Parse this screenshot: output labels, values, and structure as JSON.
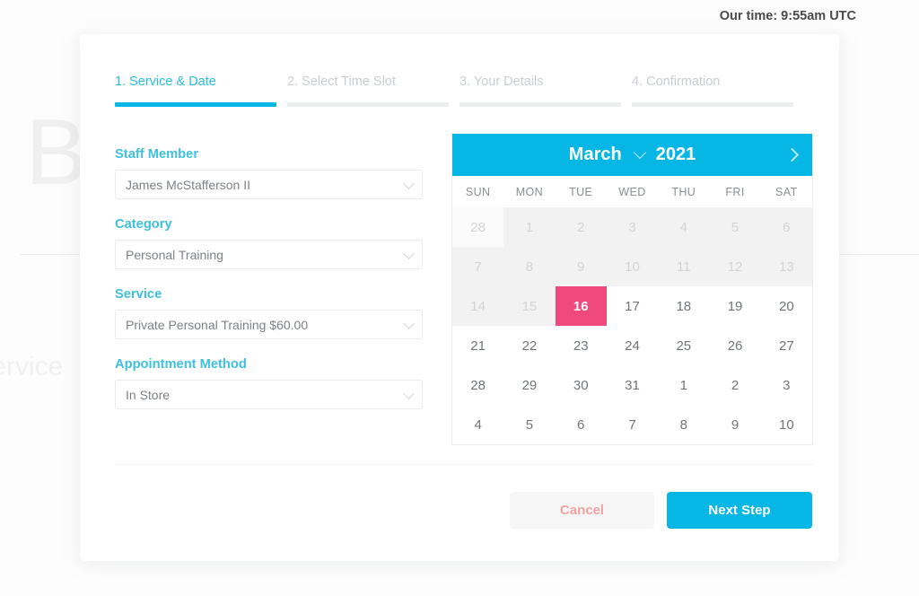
{
  "backdrop": {
    "heading": "Bo",
    "subtext": "r Service"
  },
  "clock": {
    "text": "Our time: 9:55am UTC"
  },
  "steps": [
    {
      "label": "1. Service & Date",
      "active": true
    },
    {
      "label": "2. Select Time Slot",
      "active": false
    },
    {
      "label": "3. Your Details",
      "active": false
    },
    {
      "label": "4. Confirmation",
      "active": false
    }
  ],
  "form": {
    "fields": [
      {
        "label": "Staff Member",
        "value": "James McStafferson II",
        "icon": "chevron-down-icon"
      },
      {
        "label": "Category",
        "value": "Personal Training",
        "icon": "chevron-down-icon"
      },
      {
        "label": "Service",
        "value": "Private Personal Training $60.00",
        "icon": "chevron-down-icon"
      },
      {
        "label": "Appointment Method",
        "value": "In Store",
        "icon": "chevron-down-icon"
      }
    ]
  },
  "calendar": {
    "month": "March",
    "year": "2021",
    "month_chevron_icon": "chevron-down-icon",
    "next_month_icon": "chevron-right-icon",
    "weekdays": [
      "SUN",
      "MON",
      "TUE",
      "WED",
      "THU",
      "FRI",
      "SAT"
    ],
    "selected_day": "16",
    "days": [
      {
        "label": "28",
        "state": "blank-white"
      },
      {
        "label": "1",
        "state": "disabled"
      },
      {
        "label": "2",
        "state": "disabled"
      },
      {
        "label": "3",
        "state": "disabled"
      },
      {
        "label": "4",
        "state": "disabled"
      },
      {
        "label": "5",
        "state": "disabled"
      },
      {
        "label": "6",
        "state": "disabled"
      },
      {
        "label": "7",
        "state": "disabled"
      },
      {
        "label": "8",
        "state": "disabled"
      },
      {
        "label": "9",
        "state": "disabled"
      },
      {
        "label": "10",
        "state": "disabled"
      },
      {
        "label": "11",
        "state": "disabled"
      },
      {
        "label": "12",
        "state": "disabled"
      },
      {
        "label": "13",
        "state": "disabled"
      },
      {
        "label": "14",
        "state": "disabled"
      },
      {
        "label": "15",
        "state": "disabled"
      },
      {
        "label": "16",
        "state": "selected"
      },
      {
        "label": "17",
        "state": "available"
      },
      {
        "label": "18",
        "state": "available"
      },
      {
        "label": "19",
        "state": "available"
      },
      {
        "label": "20",
        "state": "available"
      },
      {
        "label": "21",
        "state": "available"
      },
      {
        "label": "22",
        "state": "available"
      },
      {
        "label": "23",
        "state": "available"
      },
      {
        "label": "24",
        "state": "available"
      },
      {
        "label": "25",
        "state": "available"
      },
      {
        "label": "26",
        "state": "available"
      },
      {
        "label": "27",
        "state": "available"
      },
      {
        "label": "28",
        "state": "available"
      },
      {
        "label": "29",
        "state": "available"
      },
      {
        "label": "30",
        "state": "available"
      },
      {
        "label": "31",
        "state": "available"
      },
      {
        "label": "1",
        "state": "available"
      },
      {
        "label": "2",
        "state": "available"
      },
      {
        "label": "3",
        "state": "available"
      },
      {
        "label": "4",
        "state": "available"
      },
      {
        "label": "5",
        "state": "available"
      },
      {
        "label": "6",
        "state": "available"
      },
      {
        "label": "7",
        "state": "available"
      },
      {
        "label": "8",
        "state": "available"
      },
      {
        "label": "9",
        "state": "available"
      },
      {
        "label": "10",
        "state": "available"
      }
    ]
  },
  "footer": {
    "cancel_label": "Cancel",
    "next_label": "Next Step"
  },
  "colors": {
    "accent_cyan": "#06b6e5",
    "label_cyan": "#3ec1de",
    "selected_pink": "#f0497e",
    "cancel_text": "#f2a3a3",
    "disabled_grey": "#f2f2f2"
  }
}
